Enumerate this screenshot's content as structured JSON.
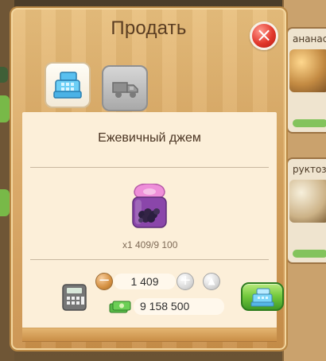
{
  "dialog": {
    "title": "Продать",
    "close_icon": "close-icon"
  },
  "tabs": {
    "sell_icon": "cash-register-icon",
    "trade_icon": "truck-icon"
  },
  "item": {
    "name": "Ежевичный джем",
    "quantity_text": "x1 409/9 100"
  },
  "controls": {
    "minus_icon": "minus-icon",
    "quantity": "1 409",
    "plus_icon": "plus-icon",
    "max_icon": "max-icon"
  },
  "price": {
    "money_icon": "money-icon",
    "total": "9 158 500"
  },
  "actions": {
    "confirm_icon": "cash-register-icon"
  },
  "background": {
    "card_1_title": "ананасн",
    "card_2_title": "руктоза"
  }
}
